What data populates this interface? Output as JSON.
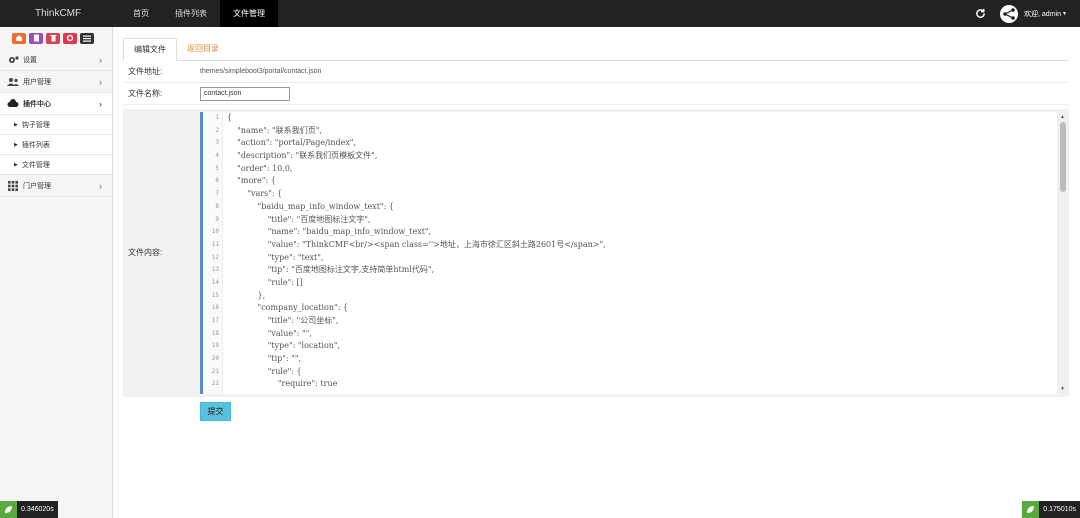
{
  "app": {
    "brand": "ThinkCMF"
  },
  "nav": {
    "items": [
      "首页",
      "插件列表",
      "文件管理"
    ],
    "active_index": 2
  },
  "user": {
    "greeting": "欢迎, admin",
    "caret": "▾"
  },
  "sidebar": {
    "shortcut_colors": [
      "#ef6d2d",
      "#9b4fb8",
      "#d84253",
      "#e5344b",
      "#333333"
    ],
    "items": [
      {
        "label": "设置",
        "icon": "gear-icon"
      },
      {
        "label": "用户管理",
        "icon": "users-icon"
      },
      {
        "label": "插件中心",
        "icon": "cloud-icon",
        "open": true
      },
      {
        "label": "门户管理",
        "icon": "grid-icon"
      }
    ],
    "sub_items": [
      "钩子管理",
      "插件列表",
      "文件管理"
    ]
  },
  "tabs": {
    "edit": "编辑文件",
    "back": "返回目录"
  },
  "form": {
    "path_label": "文件地址:",
    "path_value": "themes/simpleboot3/portal/contact.json",
    "name_label": "文件名称:",
    "name_value": "contact.json",
    "content_label": "文件内容:",
    "submit_label": "提交"
  },
  "editor": {
    "line_numbers": [
      "1",
      "2",
      "3",
      "4",
      "5",
      "6",
      "7",
      "8",
      "9",
      "10",
      "11",
      "12",
      "13",
      "14",
      "15",
      "16",
      "17",
      "18",
      "19",
      "20",
      "21",
      "22"
    ],
    "lines": [
      "{",
      "    \"name\": \"联系我们页\",",
      "    \"action\": \"portal/Page/index\",",
      "    \"description\": \"联系我们页模板文件\",",
      "    \"order\": 10.0,",
      "    \"more\": {",
      "        \"vars\": {",
      "            \"baidu_map_info_window_text\": {",
      "                \"title\": \"百度地图标注文字\",",
      "                \"name\": \"baidu_map_info_window_text\",",
      "                \"value\": \"ThinkCMF<br/><span class=''>地址，上海市徐汇区斜土路2601号</span>\",",
      "                \"type\": \"text\",",
      "                \"tip\": \"百度地图标注文字,支持简单html代码\",",
      "                \"rule\": []",
      "            },",
      "            \"company_location\": {",
      "                \"title\": \"公司坐标\",",
      "                \"value\": \"\",",
      "                \"type\": \"location\",",
      "                \"tip\": \"\",",
      "                \"rule\": {",
      "                    \"require\": true"
    ]
  },
  "perf": {
    "left": "0.346020s",
    "right": "0.175010s"
  }
}
